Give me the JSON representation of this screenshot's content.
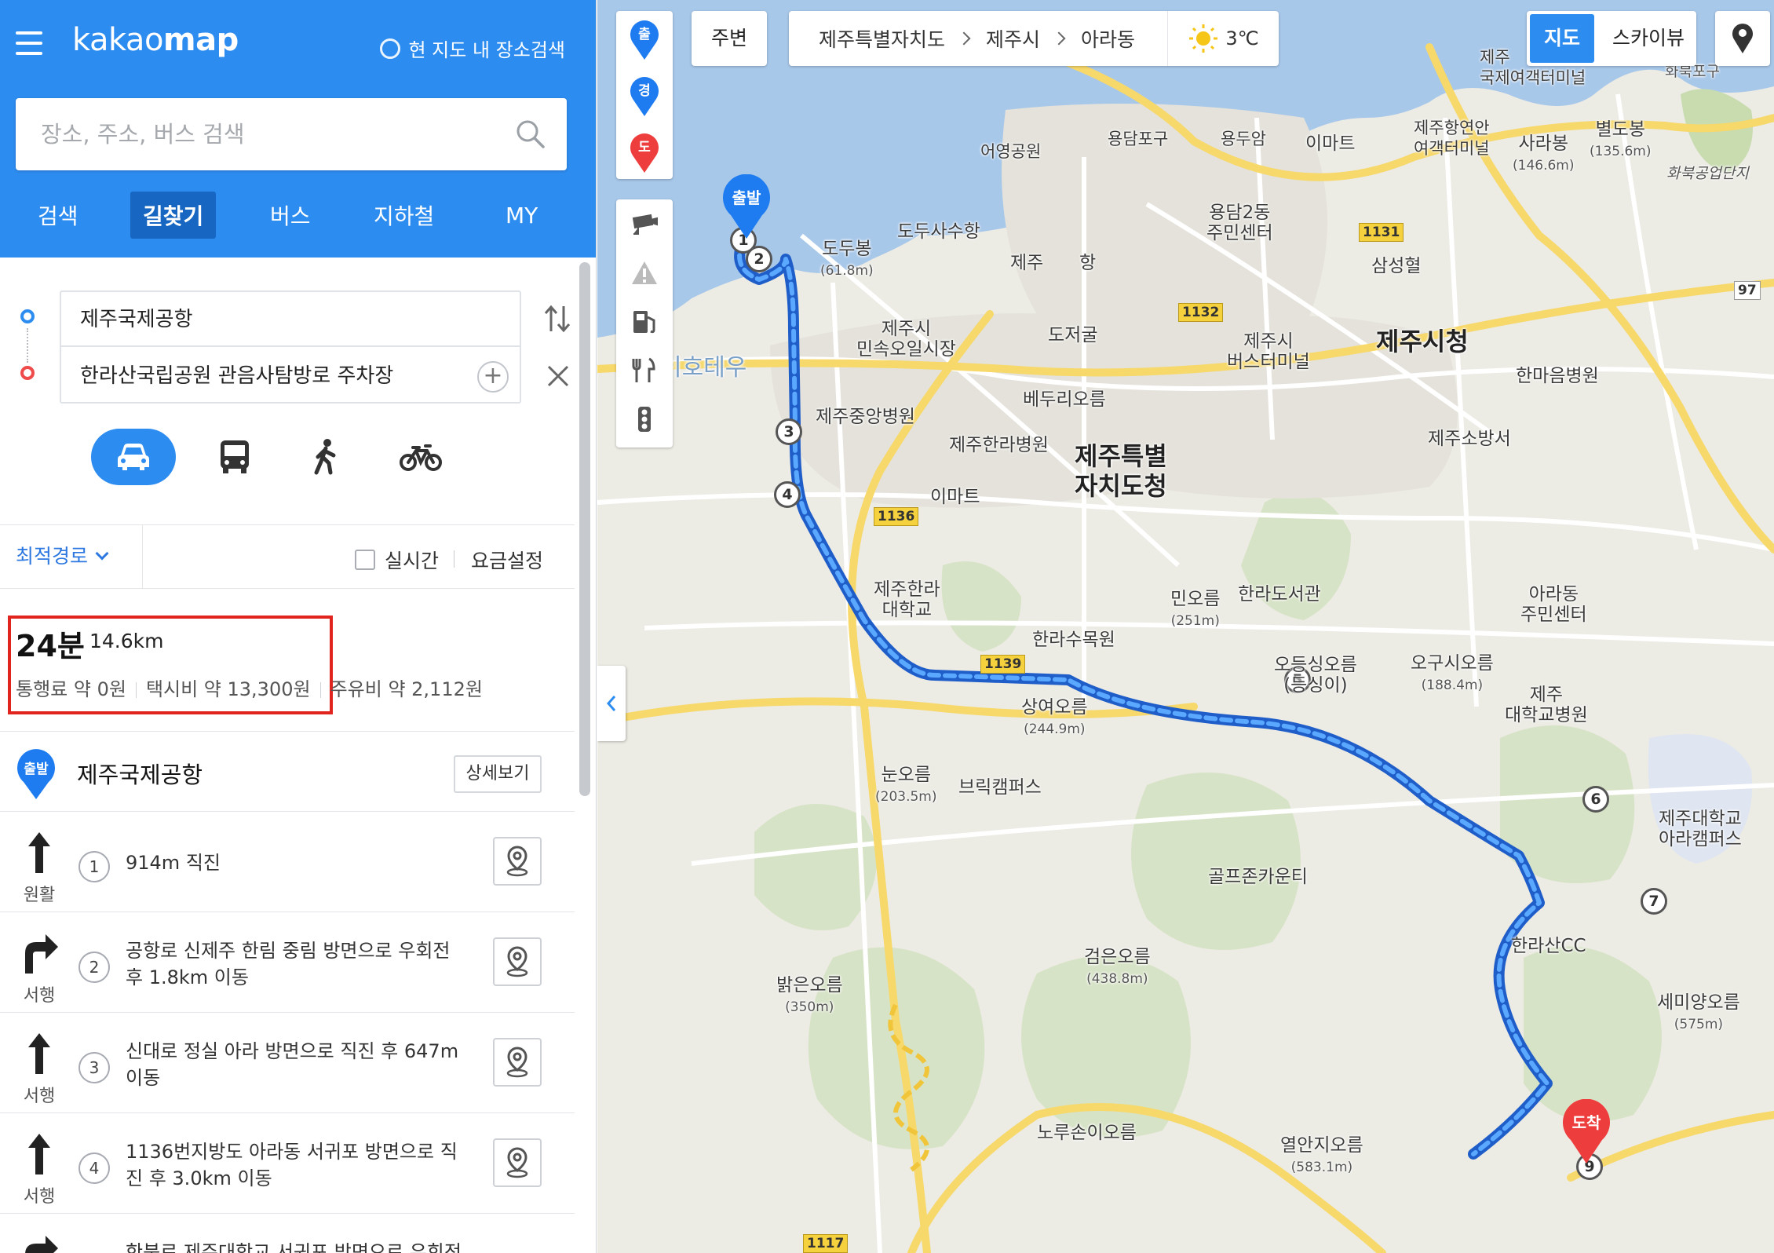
{
  "app": {
    "logo_prefix": "kakao",
    "logo_suffix": "map",
    "area_search": "현 지도 내 장소검색"
  },
  "search": {
    "placeholder": "장소, 주소, 버스 검색"
  },
  "tabs": [
    {
      "label": "검색"
    },
    {
      "label": "길찾기",
      "active": true
    },
    {
      "label": "버스"
    },
    {
      "label": "지하철"
    },
    {
      "label": "MY"
    }
  ],
  "route": {
    "start": "제주국제공항",
    "end": "한라산국립공원 관음사탐방로 주차장"
  },
  "modes": [
    "car-icon",
    "bus-icon",
    "walk-icon",
    "bike-icon"
  ],
  "options": {
    "sort": "최적경로",
    "realtime": "실시간",
    "fee_setting": "요금설정"
  },
  "summary": {
    "time": "24분",
    "distance": "14.6km",
    "toll": "통행료 약 0원",
    "taxi": "택시비 약 13,300원",
    "fuel": "주유비 약 2,112원"
  },
  "start_row": {
    "badge": "출발",
    "name": "제주국제공항",
    "detail_button": "상세보기"
  },
  "steps": [
    {
      "num": "1",
      "dir": "원활",
      "arrow": "straight",
      "text": "914m 직진"
    },
    {
      "num": "2",
      "dir": "서행",
      "arrow": "right",
      "text": "공항로 신제주 한림 중림 방면으로 우회전 후 1.8km 이동"
    },
    {
      "num": "3",
      "dir": "서행",
      "arrow": "straight",
      "text": "신대로 정실 아라 방면으로 직진 후 647m 이동"
    },
    {
      "num": "4",
      "dir": "서행",
      "arrow": "straight",
      "text": "1136번지방도 아라동 서귀포 방면으로 직진 후 3.0km 이동"
    },
    {
      "num": "",
      "dir": "",
      "arrow": "right",
      "text": "한북로 제주대학교 서귀포 방면으로 우회전"
    }
  ],
  "map": {
    "around": "주변",
    "breadcrumb": [
      "제주특별자치도",
      "제주시",
      "아라동"
    ],
    "weather": "3℃",
    "map_type": "지도",
    "sky_view": "스카이뷰",
    "pin_buttons": [
      "출",
      "경",
      "도"
    ],
    "start_marker": "출발",
    "end_marker": "도착",
    "route_points": [
      "1",
      "2",
      "3",
      "4",
      "5",
      "6",
      "7",
      "9"
    ],
    "labels": {
      "jeju_city_hall": "제주시청",
      "jeju_province_1": "제주특별",
      "jeju_province_2": "자치도청",
      "intl_terminal_1": "제주",
      "intl_terminal_2": "국제여객터미널",
      "harbor_terminal_1": "제주항연안",
      "harbor_terminal_2": "여객터미널",
      "eoyeong": "어영공원",
      "yongdam_port": "용담포구",
      "yongduam": "용두암",
      "emart1": "이마트",
      "emart2": "이마트",
      "sarabong": "사라봉",
      "sarabong_h": "(146.6m)",
      "byeoldobong": "별도봉",
      "byeoldobong_h": "(135.6m)",
      "hwabuk": "화북공업단지",
      "hwabuk_port": "화북포구",
      "dodubong": "도두봉",
      "dodubong_h": "(61.8m)",
      "dodusa": "도두사수항",
      "yongdam2": "용담2동",
      "yongdam2_c": "주민센터",
      "samsung": "삼성혈",
      "jeju_airport_part": "제주",
      "airport_tail": "항",
      "market_1": "제주시",
      "market_2": "민속오일시장",
      "dojeogul": "도저굴",
      "bus_terminal_1": "제주시",
      "bus_terminal_2": "버스터미널",
      "halla_hospital": "한마음병원",
      "fire_station": "제주소방서",
      "central_hospital": "제주중앙병원",
      "halla_hosp2": "제주한라병원",
      "beduri": "베두리오름",
      "ihotewoo": "이호테우",
      "jeju_halla_univ_1": "제주한라",
      "jeju_halla_univ_2": "대학교",
      "mio": "민오름",
      "mio_h": "(251m)",
      "halla_library": "한라도서관",
      "arboretum": "한라수목원",
      "ara_center_1": "아라동",
      "ara_center_2": "주민센터",
      "odeungsing": "오등싱오름",
      "odeungsing_2": "(등싱이)",
      "ogusi": "오구시오름",
      "ogusi_h": "(188.4m)",
      "jeju_univ_hosp_1": "제주",
      "jeju_univ_hosp_2": "대학교병원",
      "sangyeo": "상여오름",
      "sangyeo_h": "(244.9m)",
      "nun": "눈오름",
      "nun_h": "(203.5m)",
      "brick": "브릭캠퍼스",
      "golfzone": "골프존카운티",
      "jeju_univ_ara_1": "제주대학교",
      "jeju_univ_ara_2": "아라캠퍼스",
      "hallasan_cc": "한라산CC",
      "semiyang": "세미양오름",
      "semiyang_h": "(575m)",
      "geomeun": "검은오름",
      "geomeun_h": "(438.8m)",
      "balgeun": "밝은오름",
      "balgeun_h": "(350m)",
      "noruson": "노루손이오름",
      "yeolan": "열안지오름",
      "yeolan_h": "(583.1m)"
    },
    "road_numbers": [
      "1131",
      "1132",
      "1136",
      "1139",
      "97",
      "1117"
    ]
  }
}
